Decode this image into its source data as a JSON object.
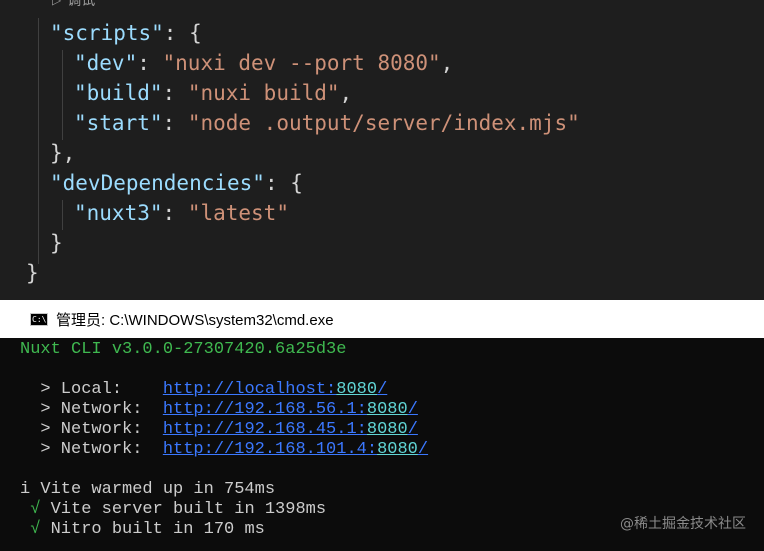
{
  "editor": {
    "codelens_label": "调试",
    "lines": {
      "scripts_key": "\"scripts\"",
      "dev_key": "\"dev\"",
      "dev_val": "\"nuxi dev --port 8080\"",
      "build_key": "\"build\"",
      "build_val": "\"nuxi build\"",
      "start_key": "\"start\"",
      "start_val": "\"node .output/server/index.mjs\"",
      "devdeps_key": "\"devDependencies\"",
      "nuxt_key": "\"nuxt3\"",
      "nuxt_val": "\"latest\""
    }
  },
  "cmd": {
    "title": "管理员: C:\\WINDOWS\\system32\\cmd.exe",
    "cli_version": "Nuxt CLI v3.0.0-27307420.6a25d3e",
    "local_label": "  > Local:    ",
    "local_host": "http://localhost:",
    "local_port": "8080",
    "network_label": "  > Network:  ",
    "network1_host": "http://192.168.56.1:",
    "network2_host": "http://192.168.45.1:",
    "network3_host": "http://192.168.101.4:",
    "port": "8080",
    "slash": "/",
    "vite_warm": "i Vite warmed up in 754ms",
    "check": " √",
    "vite_server": " Vite server built in 1398ms",
    "nitro": " Nitro built in 170 ms"
  },
  "watermark": "@稀土掘金技术社区",
  "colors": {
    "editor_bg": "#1e1e1e",
    "json_key": "#9cdcfe",
    "json_string": "#ce9178",
    "console_bg": "#0c0c0c",
    "console_green": "#3fb950",
    "console_link": "#3b78ff"
  }
}
